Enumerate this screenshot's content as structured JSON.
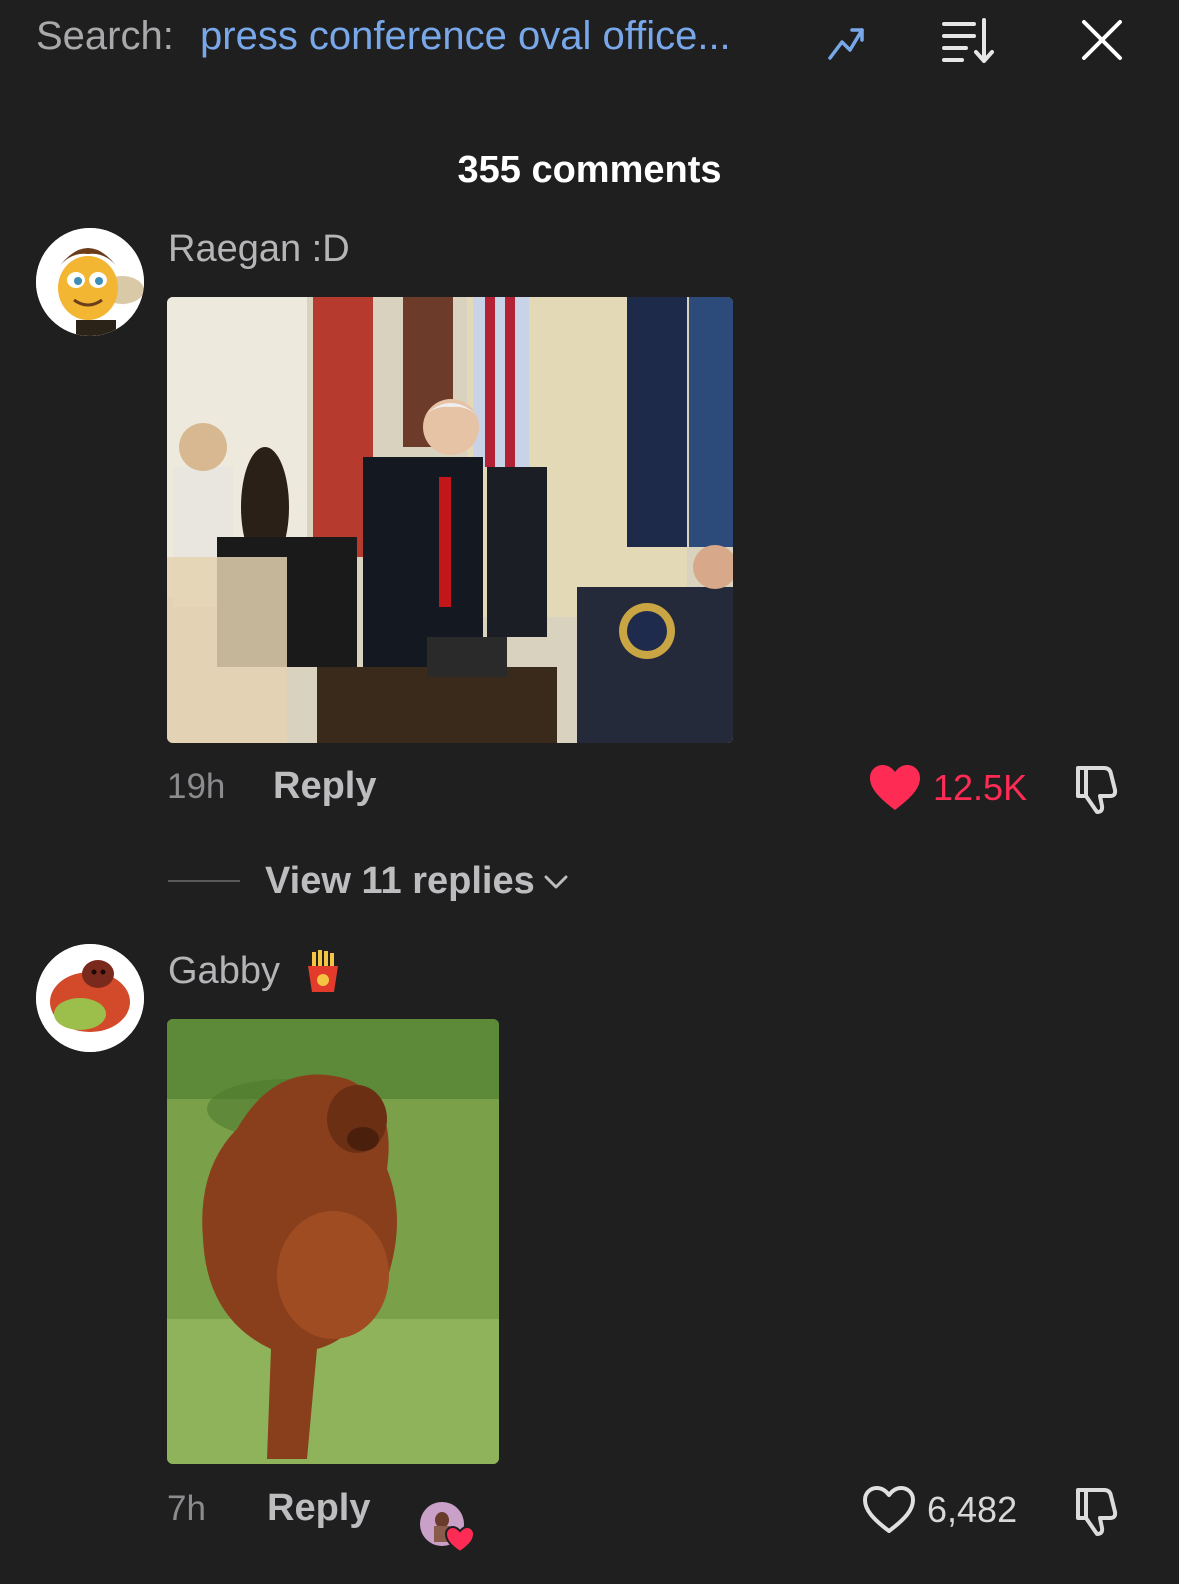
{
  "header": {
    "search_label": "Search:",
    "search_query": "press conference oval office..."
  },
  "comments_count": "355 comments",
  "comments": [
    {
      "username": "Raegan :D",
      "time": "19h",
      "reply_label": "Reply",
      "likes": "12.5K",
      "liked": true,
      "view_replies": "View 11 replies"
    },
    {
      "username": "Gabby",
      "time": "7h",
      "reply_label": "Reply",
      "likes": "6,482",
      "liked": false
    }
  ],
  "colors": {
    "background": "#1f1f20",
    "accent_blue": "#79a8ea",
    "like_red": "#fe2c55"
  },
  "icons": [
    "trending-icon",
    "sort-icon",
    "close-icon",
    "heart-icon",
    "dislike-icon",
    "chevron-down-icon",
    "fries-emoji-icon",
    "creator-liked-icon"
  ]
}
